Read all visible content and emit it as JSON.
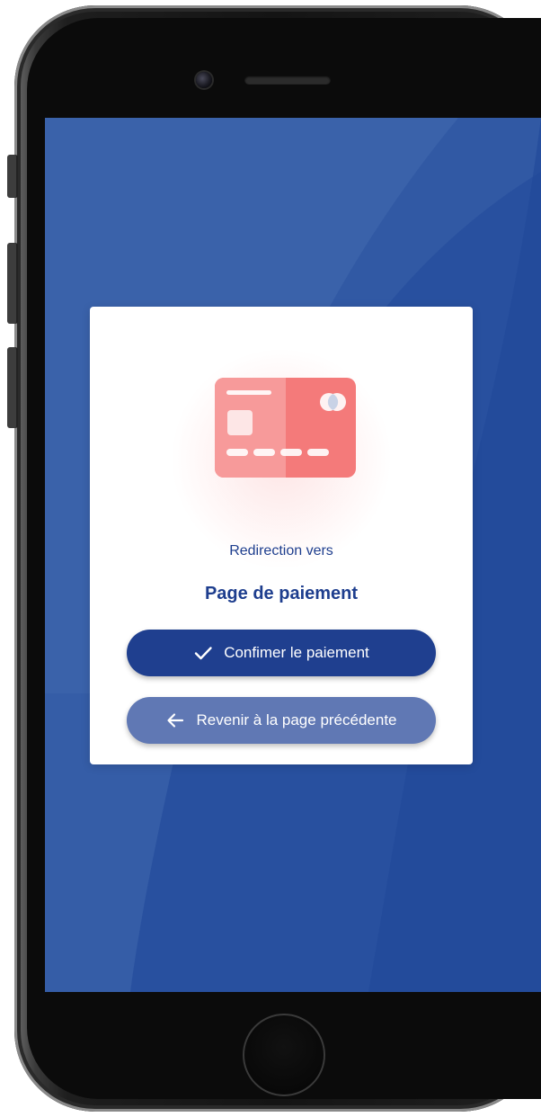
{
  "dialog": {
    "subtitle": "Redirection vers",
    "title": "Page de paiement",
    "confirm_button": {
      "label": "Confimer le paiement",
      "icon": "check-icon"
    },
    "back_button": {
      "label": "Revenir à la page précédente",
      "icon": "arrow-left-icon"
    },
    "illustration": "credit-card-icon"
  },
  "colors": {
    "screen_background": "#28509f",
    "primary": "#1f3f8f",
    "secondary": "#6078b4",
    "text": "#1e3e8e",
    "card_illustration": "#f47a7a"
  }
}
